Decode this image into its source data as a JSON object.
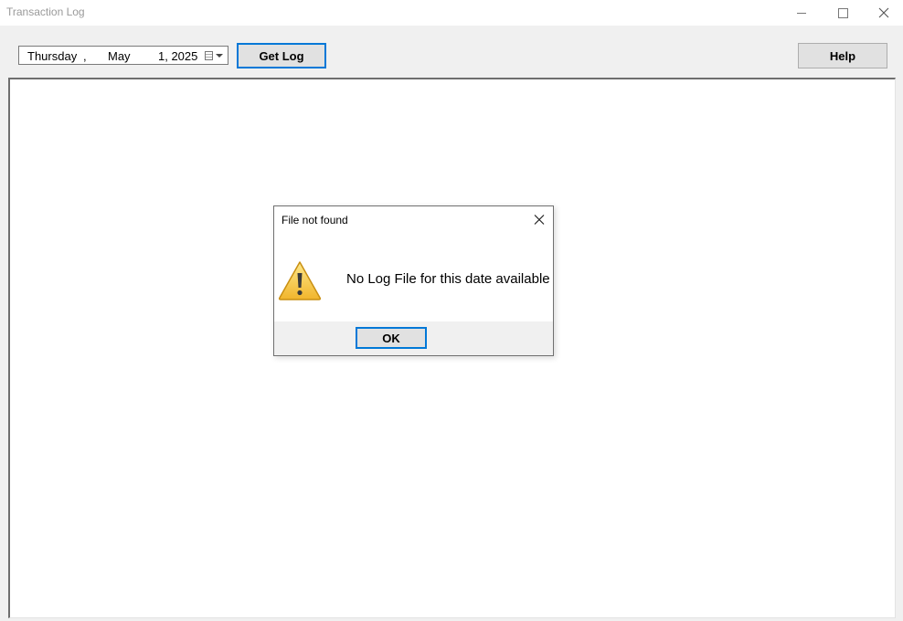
{
  "window": {
    "title": "Transaction Log"
  },
  "toolbar": {
    "date": {
      "weekday": "Thursday",
      "comma": ",",
      "month": "May",
      "day_year": "1, 2025"
    },
    "get_log_label": "Get Log",
    "help_label": "Help"
  },
  "dialog": {
    "title": "File not found",
    "message": "No Log File for this date available",
    "ok_label": "OK",
    "icon": "warning-icon"
  },
  "colors": {
    "focus_border": "#0078d7",
    "warning_fill": "#f5c542"
  }
}
